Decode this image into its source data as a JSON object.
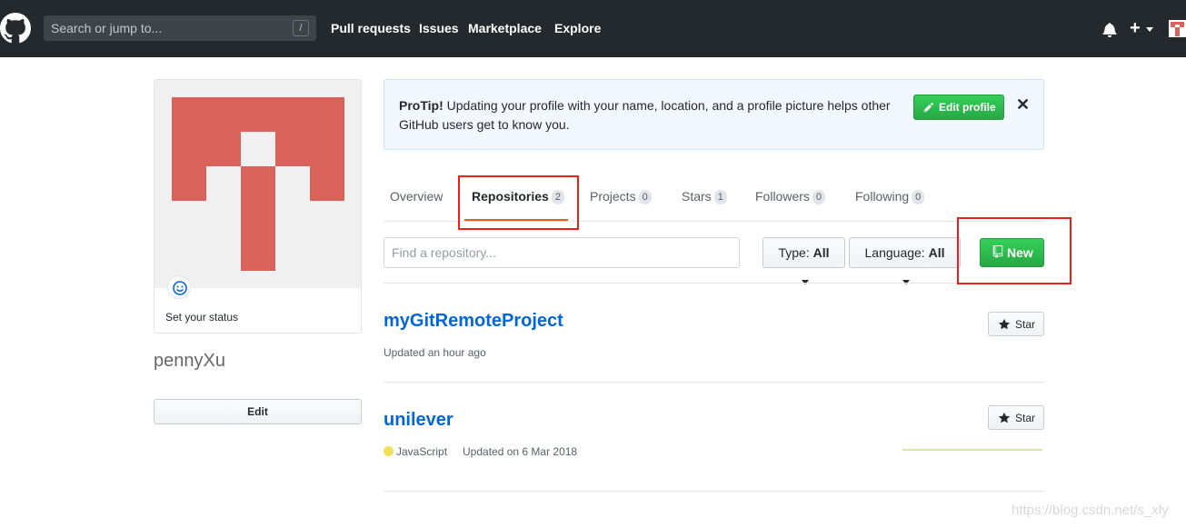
{
  "header": {
    "search_placeholder": "Search or jump to...",
    "search_shortcut": "/",
    "nav": [
      "Pull requests",
      "Issues",
      "Marketplace",
      "Explore"
    ],
    "plus": "+"
  },
  "profile": {
    "status_text": "Set your status",
    "username": "pennyXu",
    "edit_label": "Edit",
    "avatar_color": "#d9625a"
  },
  "protip": {
    "title": "ProTip!",
    "message": "Updating your profile with your name, location, and a profile picture helps other GitHub users get to know you.",
    "button_label": "Edit profile",
    "close": "✕"
  },
  "tabs": [
    {
      "label": "Overview",
      "count": null
    },
    {
      "label": "Repositories",
      "count": "2"
    },
    {
      "label": "Projects",
      "count": "0"
    },
    {
      "label": "Stars",
      "count": "1"
    },
    {
      "label": "Followers",
      "count": "0"
    },
    {
      "label": "Following",
      "count": "0"
    }
  ],
  "filters": {
    "find_placeholder": "Find a repository...",
    "type_label": "Type:",
    "type_value": "All",
    "language_label": "Language:",
    "language_value": "All",
    "new_label": "New"
  },
  "repos": [
    {
      "name": "myGitRemoteProject",
      "language": "",
      "updated": "Updated an hour ago",
      "star_label": "Star"
    },
    {
      "name": "unilever",
      "language": "JavaScript",
      "language_color": "#f1e05a",
      "updated": "Updated on 6 Mar 2018",
      "star_label": "Star"
    }
  ],
  "watermark": "https://blog.csdn.net/s_xly",
  "colors": {
    "accent_green": "#28a745",
    "link_blue": "#0366d6",
    "annotation_red": "#e8221b",
    "tab_underline": "#e36209"
  }
}
